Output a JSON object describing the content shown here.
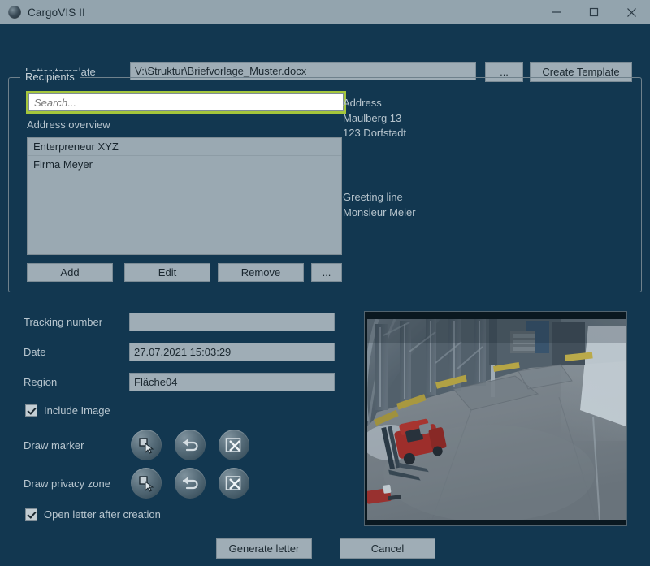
{
  "window": {
    "title": "CargoVIS II",
    "icon": "globe-icon",
    "minimize_label": "─",
    "maximize_label": "□",
    "close_label": "✕"
  },
  "template_row": {
    "label": "Letter template",
    "path_value": "V:\\Struktur\\Briefvorlage_Muster.docx",
    "browse_label": "...",
    "create_label": "Create Template"
  },
  "recipients": {
    "group_title": "Recipients",
    "search_placeholder": "Search...",
    "search_value": "",
    "overview_label": "Address overview",
    "list_items": [
      "Enterpreneur XYZ",
      "Firma Meyer"
    ],
    "address_heading": "Address",
    "address_lines": [
      "Maulberg 13",
      "123 Dorfstadt"
    ],
    "greeting_heading": "Greeting line",
    "greeting_lines": [
      "Monsieur Meier"
    ],
    "buttons": {
      "add": "Add",
      "edit": "Edit",
      "remove": "Remove",
      "more": "..."
    }
  },
  "details": {
    "tracking_label": "Tracking number",
    "tracking_value": "",
    "date_label": "Date",
    "date_value": "27.07.2021 15:03:29",
    "region_label": "Region",
    "region_value": "Fläche04",
    "include_image_label": "Include Image",
    "include_image_checked": true,
    "draw_marker_label": "Draw marker",
    "draw_privacy_label": "Draw privacy zone",
    "open_after_label": "Open letter after creation",
    "open_after_checked": true,
    "tool_icons": [
      "draw-rectangle-cursor-icon",
      "undo-arrow-icon",
      "delete-rectangle-x-icon"
    ]
  },
  "preview": {
    "description": "warehouse-surveillance-camera-still"
  },
  "footer": {
    "generate_label": "Generate letter",
    "cancel_label": "Cancel"
  },
  "colors": {
    "window_background": "#123750",
    "titlebar": "#93a4ae",
    "control_face": "#9fadb6",
    "highlight": "#a4c63c",
    "text": "#c9d4da"
  }
}
